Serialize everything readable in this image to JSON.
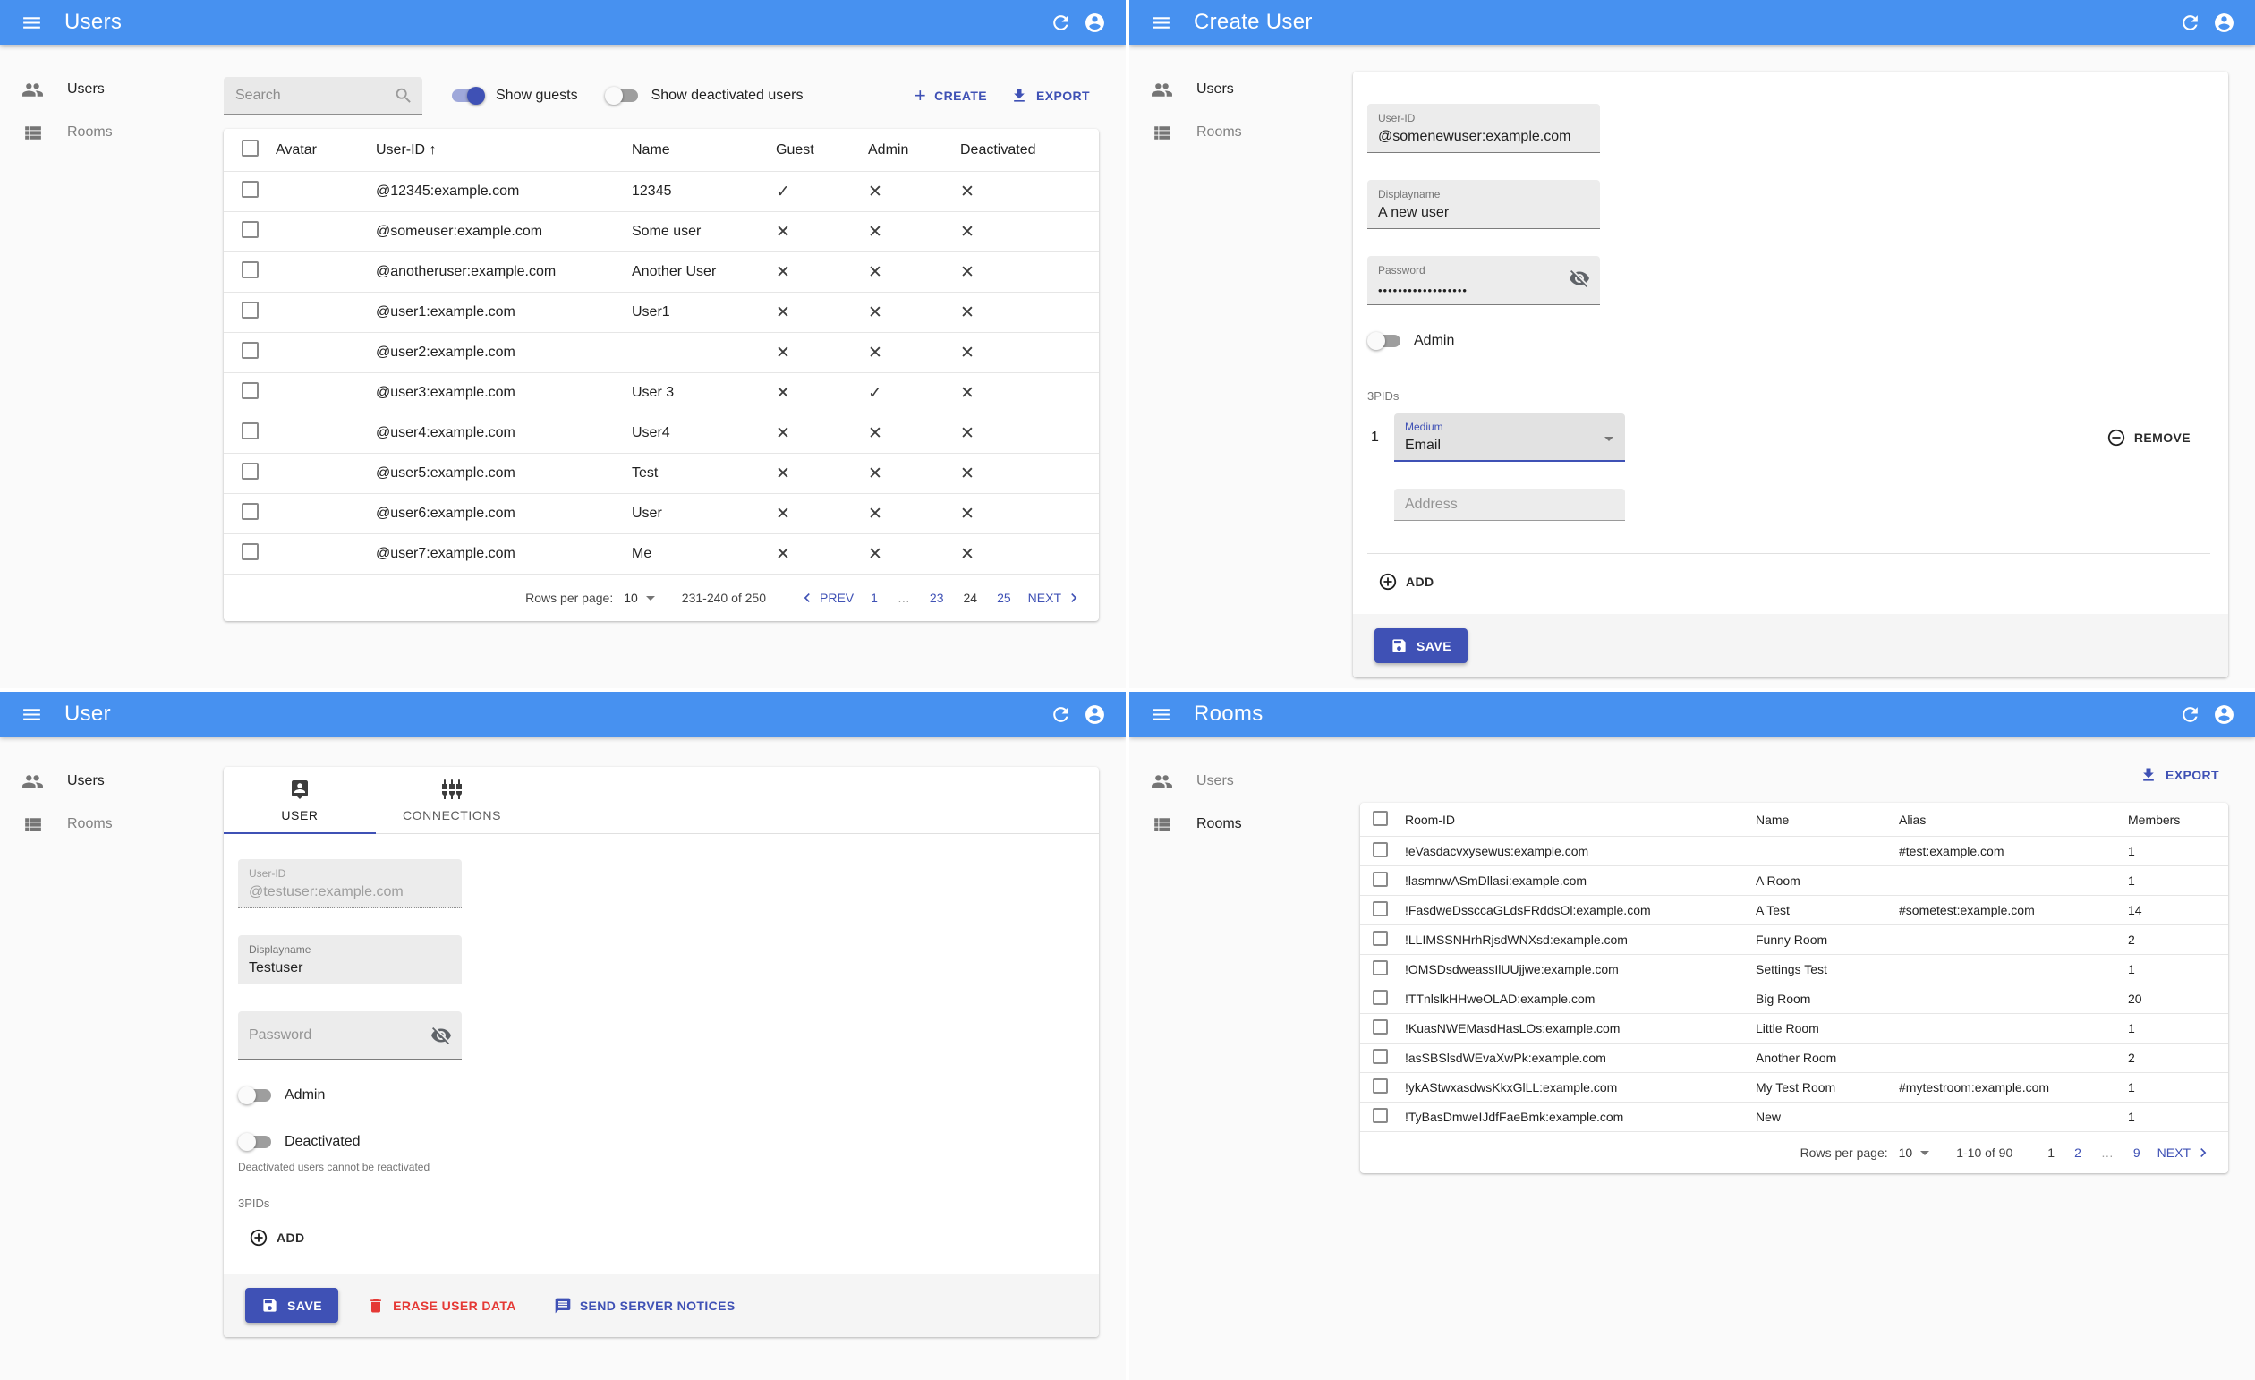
{
  "theme": {
    "appbar_color": "#4791f0",
    "accent_color": "#3f51b5",
    "error_color": "#e53935"
  },
  "icons": {
    "check_glyph": "✓",
    "cross_glyph": "✕",
    "sort_asc_glyph": "↑",
    "plus_glyph": "+"
  },
  "sidebar": {
    "users_label": "Users",
    "rooms_label": "Rooms"
  },
  "panels": {
    "users_list": {
      "title": "Users",
      "toolbar": {
        "search_placeholder": "Search",
        "show_guests_label": "Show guests",
        "show_deactivated_label": "Show deactivated users",
        "create_label": "CREATE",
        "export_label": "EXPORT"
      },
      "table": {
        "headers": {
          "avatar": "Avatar",
          "user_id": "User-ID",
          "name": "Name",
          "guest": "Guest",
          "admin": "Admin",
          "deactivated": "Deactivated"
        },
        "rows": [
          {
            "user_id": "@12345:example.com",
            "name": "12345",
            "guest": true,
            "admin": false,
            "deactivated": false
          },
          {
            "user_id": "@someuser:example.com",
            "name": "Some user",
            "guest": false,
            "admin": false,
            "deactivated": false
          },
          {
            "user_id": "@anotheruser:example.com",
            "name": "Another User",
            "guest": false,
            "admin": false,
            "deactivated": false
          },
          {
            "user_id": "@user1:example.com",
            "name": "User1",
            "guest": false,
            "admin": false,
            "deactivated": false
          },
          {
            "user_id": "@user2:example.com",
            "name": "",
            "guest": false,
            "admin": false,
            "deactivated": false
          },
          {
            "user_id": "@user3:example.com",
            "name": "User 3",
            "guest": false,
            "admin": true,
            "deactivated": false
          },
          {
            "user_id": "@user4:example.com",
            "name": "User4",
            "guest": false,
            "admin": false,
            "deactivated": false
          },
          {
            "user_id": "@user5:example.com",
            "name": "Test",
            "guest": false,
            "admin": false,
            "deactivated": false
          },
          {
            "user_id": "@user6:example.com",
            "name": "User",
            "guest": false,
            "admin": false,
            "deactivated": false
          },
          {
            "user_id": "@user7:example.com",
            "name": "Me",
            "guest": false,
            "admin": false,
            "deactivated": false
          }
        ]
      },
      "pagination": {
        "rows_per_page_label": "Rows per page:",
        "rows_per_page": "10",
        "range": "231-240 of 250",
        "prev_label": "PREV",
        "next_label": "NEXT",
        "pages": [
          {
            "label": "1",
            "state": "link"
          },
          {
            "label": "…",
            "state": "ellipsis"
          },
          {
            "label": "23",
            "state": "link"
          },
          {
            "label": "24",
            "state": "current"
          },
          {
            "label": "25",
            "state": "link"
          }
        ]
      }
    },
    "create_user": {
      "title": "Create User",
      "form": {
        "user_id_label": "User-ID",
        "user_id_value": "@somenewuser:example.com",
        "displayname_label": "Displayname",
        "displayname_value": "A new user",
        "password_label": "Password",
        "password_value": "••••••••••••••••••",
        "admin_label": "Admin",
        "threepids_label": "3PIDs",
        "threepid_index": "1",
        "medium_label": "Medium",
        "medium_value": "Email",
        "remove_label": "REMOVE",
        "address_placeholder": "Address",
        "add_label": "ADD",
        "save_label": "SAVE"
      }
    },
    "user_edit": {
      "title": "User",
      "tabs": {
        "user": "USER",
        "connections": "CONNECTIONS"
      },
      "form": {
        "user_id_label": "User-ID",
        "user_id_value": "@testuser:example.com",
        "displayname_label": "Displayname",
        "displayname_value": "Testuser",
        "password_placeholder": "Password",
        "admin_label": "Admin",
        "deactivated_label": "Deactivated",
        "deactivated_help": "Deactivated users cannot be reactivated",
        "threepids_label": "3PIDs",
        "add_label": "ADD"
      },
      "footer": {
        "save_label": "SAVE",
        "erase_label": "ERASE USER DATA",
        "notices_label": "SEND SERVER NOTICES"
      }
    },
    "rooms": {
      "title": "Rooms",
      "export_label": "EXPORT",
      "table": {
        "headers": {
          "room_id": "Room-ID",
          "name": "Name",
          "alias": "Alias",
          "members": "Members"
        },
        "rows": [
          {
            "room_id": "!eVasdacvxysewus:example.com",
            "name": "",
            "alias": "#test:example.com",
            "members": "1"
          },
          {
            "room_id": "!lasmnwASmDllasi:example.com",
            "name": "A Room",
            "alias": "",
            "members": "1"
          },
          {
            "room_id": "!FasdweDssccaGLdsFRddsOl:example.com",
            "name": "A Test",
            "alias": "#sometest:example.com",
            "members": "14"
          },
          {
            "room_id": "!LLIMSSNHrhRjsdWNXsd:example.com",
            "name": "Funny Room",
            "alias": "",
            "members": "2"
          },
          {
            "room_id": "!OMSDsdweassIlUUjjwe:example.com",
            "name": "Settings Test",
            "alias": "",
            "members": "1"
          },
          {
            "room_id": "!TTnlslkHHweOLAD:example.com",
            "name": "Big Room",
            "alias": "",
            "members": "20"
          },
          {
            "room_id": "!KuasNWEMasdHasLOs:example.com",
            "name": "Little Room",
            "alias": "",
            "members": "1"
          },
          {
            "room_id": "!asSBSlsdWEvaXwPk:example.com",
            "name": "Another Room",
            "alias": "",
            "members": "2"
          },
          {
            "room_id": "!ykAStwxasdwsKkxGlLL:example.com",
            "name": "My Test Room",
            "alias": "#mytestroom:example.com",
            "members": "1"
          },
          {
            "room_id": "!TyBasDmweIJdfFaeBmk:example.com",
            "name": "New",
            "alias": "",
            "members": "1"
          }
        ]
      },
      "pagination": {
        "rows_per_page_label": "Rows per page:",
        "rows_per_page": "10",
        "range": "1-10 of 90",
        "next_label": "NEXT",
        "pages": [
          {
            "label": "1",
            "state": "current"
          },
          {
            "label": "2",
            "state": "link"
          },
          {
            "label": "…",
            "state": "ellipsis"
          },
          {
            "label": "9",
            "state": "link"
          }
        ]
      }
    }
  }
}
